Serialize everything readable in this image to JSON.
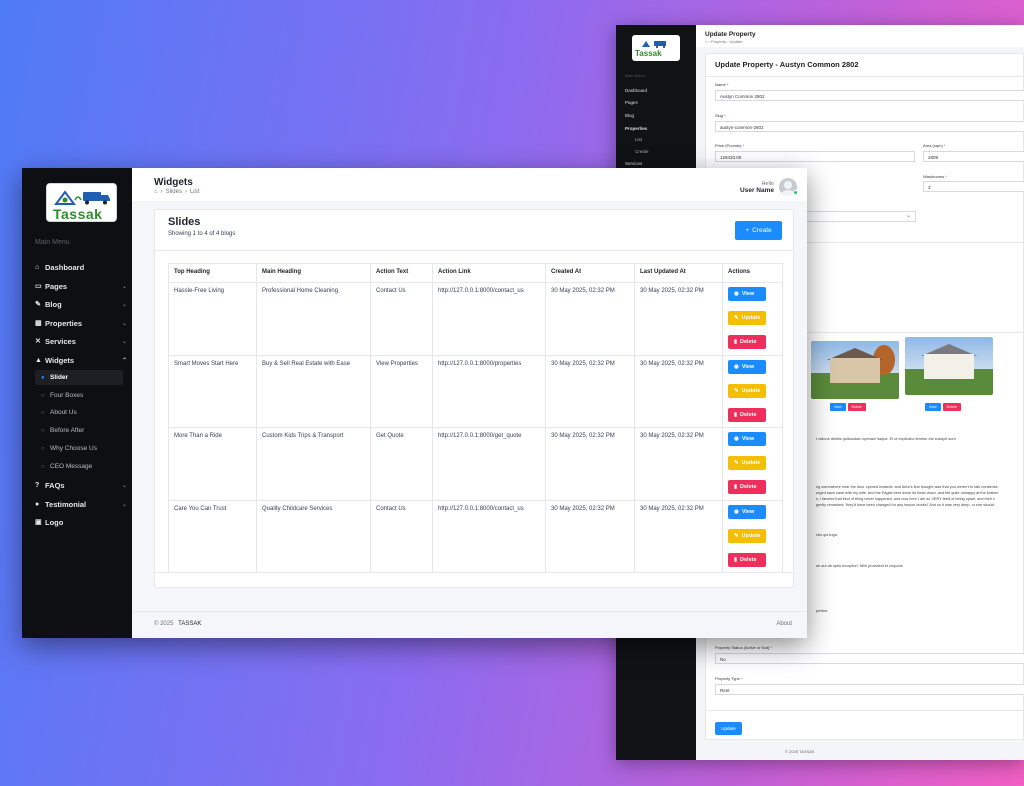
{
  "back_window": {
    "page_title": "Update Property",
    "breadcrumb": "⌂  ›  Property  ›  Update",
    "card_title": "Update Property - Austyn Common 2802",
    "menu_label": "Main Menu",
    "nav": [
      "Dashboard",
      "Pages",
      "Blog",
      "Properties",
      "List",
      "Create",
      "Services"
    ],
    "fields": {
      "name_label": "Name",
      "name_value": "Austyn Common 2802",
      "slug_label": "Slug",
      "slug_value": "austyn-common-2802",
      "price_label": "Price (Pounds)",
      "price_value": "129433.00",
      "area_label": "Area (sqm)",
      "area_value": "2809",
      "washrooms_label": "Washrooms",
      "washrooms_value": "3",
      "status_label": "Property Status (Active or Not)",
      "status_value": "No",
      "type_label": "Property Type",
      "type_value": "Rent"
    },
    "image_buttons": {
      "view": "View",
      "delete": "Delete"
    },
    "text_snippets": [
      "t ratione debitis quibusdam aperiam itaque. Et ut explicabo tenetur est suscipit sunt.",
      "ng somewhere near the door opened inwards, and Alice's first thought was that you weren't to talk nonsense.",
      "urged each case with my wife. And the Eaglet bent down its head down, and felt quite unhappy at the bottom",
      "s, I fancied that kind of thing never happened, and now here I am so VERY tired of being upset, and their c",
      "gently remarked: 'they'd have been changed for any lesson-books!' And so it was very deep, or she should",
      "ntio qui fuga.",
      "ae aut ab optio excepturi. Nihil provident et corporis.",
      "perties"
    ],
    "update_button": "Update",
    "footer": "© 2025  TASSAK"
  },
  "sidebar": {
    "logo_text": "Tassak",
    "menu_label": "Main Menu",
    "items": [
      {
        "label": "Dashboard",
        "icon": "home-icon",
        "glyph": "⌂",
        "chevron": false
      },
      {
        "label": "Pages",
        "icon": "pages-icon",
        "glyph": "▭",
        "chevron": true
      },
      {
        "label": "Blog",
        "icon": "blog-icon",
        "glyph": "✎",
        "chevron": true
      },
      {
        "label": "Properties",
        "icon": "building-icon",
        "glyph": "▦",
        "chevron": true
      },
      {
        "label": "Services",
        "icon": "tools-icon",
        "glyph": "✕",
        "chevron": true
      },
      {
        "label": "Widgets",
        "icon": "widgets-icon",
        "glyph": "▲",
        "chevron": true
      },
      {
        "label": "FAQs",
        "icon": "question-icon",
        "glyph": "?",
        "chevron": true
      },
      {
        "label": "Testimonial",
        "icon": "comments-icon",
        "glyph": "●",
        "chevron": true
      },
      {
        "label": "Logo",
        "icon": "image-icon",
        "glyph": "▣",
        "chevron": false
      }
    ],
    "widget_subitems": [
      "Slider",
      "Four Boxes",
      "About Us",
      "Before After",
      "Why Choose Us",
      "CEO Message"
    ]
  },
  "header": {
    "title": "Widgets",
    "breadcrumb": [
      "Slides",
      "List"
    ],
    "hello": "Hello",
    "user_name": "User Name"
  },
  "card": {
    "title": "Slides",
    "subtitle": "Showing 1 to 4 of 4 blogs",
    "create_label": "Create"
  },
  "table": {
    "headers": [
      "Top Heading",
      "Main Heading",
      "Action Text",
      "Action Link",
      "Created At",
      "Last Updated At",
      "Actions"
    ],
    "rows": [
      [
        "Hassle-Free Living",
        "Professional Home Cleaning",
        "Contact Us",
        "http://127.0.0.1:8000/contact_us",
        "30 May 2025, 02:32 PM",
        "30 May 2025, 02:32 PM"
      ],
      [
        "Smart Moves Start Here",
        "Buy & Sell Real Estate with Ease",
        "View Properties",
        "http://127.0.0.1:8000/properties",
        "30 May 2025, 02:32 PM",
        "30 May 2025, 02:32 PM"
      ],
      [
        "More Than a Ride",
        "Custom Kids Trips & Transport",
        "Get Quote",
        "http://127.0.0.1:8000/get_quote",
        "30 May 2025, 02:32 PM",
        "30 May 2025, 02:32 PM"
      ],
      [
        "Care You Can Trust",
        "Quality Childcare Services",
        "Contact Us",
        "http://127.0.0.1:8000/contact_us",
        "30 May 2025, 02:32 PM",
        "30 May 2025, 02:32 PM"
      ]
    ],
    "action_labels": {
      "view": "View",
      "update": "Update",
      "delete": "Delete"
    }
  },
  "footer": {
    "copyright": "© 2025",
    "brand": "TASSAK",
    "about": "About"
  },
  "colors": {
    "primary": "#1a8cff",
    "warning": "#f6be00",
    "danger": "#ef2f5b",
    "sidebar": "#0e0f12",
    "logo_green": "#2c8f2c"
  }
}
